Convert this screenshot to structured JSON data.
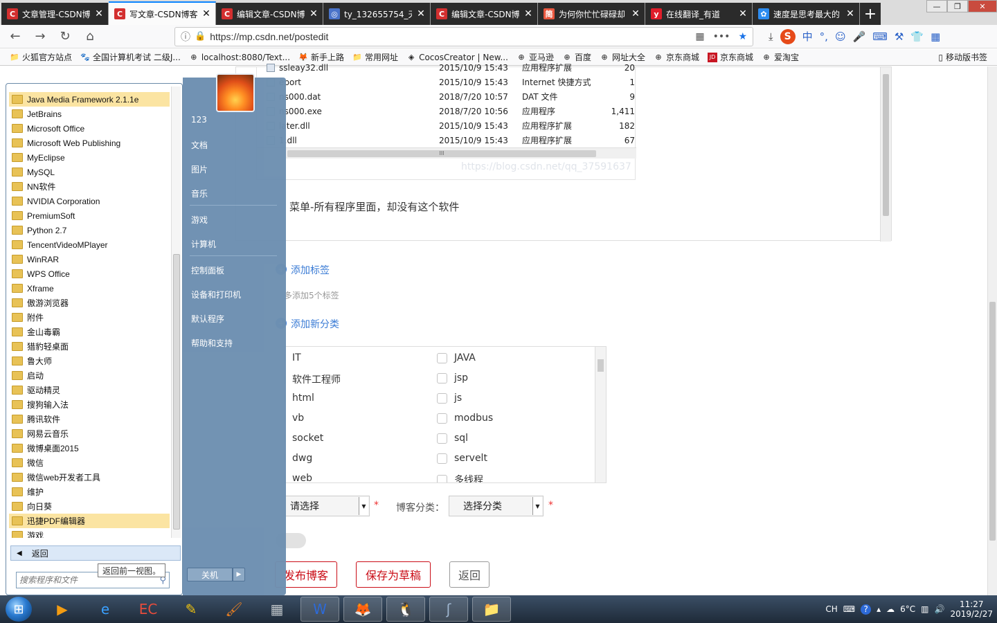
{
  "tabs": [
    {
      "title": "文章管理-CSDN博客",
      "fav": "C",
      "color": "#d32f2f",
      "active": false
    },
    {
      "title": "写文章-CSDN博客",
      "fav": "C",
      "color": "#d32f2f",
      "active": true
    },
    {
      "title": "编辑文章-CSDN博客",
      "fav": "C",
      "color": "#d32f2f",
      "active": false
    },
    {
      "title": "ty_132655754_天",
      "fav": "◎",
      "color": "#4a73c9",
      "active": false
    },
    {
      "title": "编辑文章-CSDN博客",
      "fav": "C",
      "color": "#d32f2f",
      "active": false
    },
    {
      "title": "为何你忙忙碌碌却",
      "fav": "简",
      "color": "#e9573f",
      "active": false
    },
    {
      "title": "在线翻译_有道",
      "fav": "y",
      "color": "#e01e2a",
      "active": false
    },
    {
      "title": "速度是思考最大的",
      "fav": "✿",
      "color": "#2d8cf0",
      "active": false
    }
  ],
  "url": "https://mp.csdn.net/postedit",
  "bookmarks": [
    {
      "label": "火狐官方站点",
      "icon": "folder"
    },
    {
      "label": "全国计算机考试 二级J...",
      "icon": "paw"
    },
    {
      "label": "localhost:8080/Text...",
      "icon": "globe"
    },
    {
      "label": "新手上路",
      "icon": "fox"
    },
    {
      "label": "常用网址",
      "icon": "folder"
    },
    {
      "label": "CocosCreator | New...",
      "icon": "cocos"
    },
    {
      "label": "亚马逊",
      "icon": "globe"
    },
    {
      "label": "百度",
      "icon": "globe"
    },
    {
      "label": "网址大全",
      "icon": "globe"
    },
    {
      "label": "京东商城",
      "icon": "globe"
    },
    {
      "label": "京东商城",
      "icon": "jd"
    },
    {
      "label": "爱淘宝",
      "icon": "globe"
    }
  ],
  "mobile_bookmarks": "移动版书签",
  "files": [
    {
      "name": "ssleay32.dll",
      "date": "2015/10/9 15:43",
      "type": "应用程序扩展",
      "size": "20"
    },
    {
      "name": "eport",
      "date": "2015/10/9 15:43",
      "type": "Internet 快捷方式",
      "size": "1"
    },
    {
      "name": "ns000.dat",
      "date": "2018/7/20 10:57",
      "type": "DAT 文件",
      "size": "9"
    },
    {
      "name": "ns000.exe",
      "date": "2018/7/20 10:56",
      "type": "应用程序",
      "size": "1,411"
    },
    {
      "name": "later.dll",
      "date": "2015/10/9 15:43",
      "type": "应用程序扩展",
      "size": "182"
    },
    {
      "name": "1.dll",
      "date": "2015/10/9 15:43",
      "type": "应用程序扩展",
      "size": "67"
    }
  ],
  "watermark": "https://blog.csdn.net/qq_37591637",
  "article_text": "菜单-所有程序里面，却没有这个软件",
  "tags": {
    "add_label": "添加标签",
    "hint": "多添加5个标签"
  },
  "categories": {
    "add_label": "添加新分类"
  },
  "category_options": [
    {
      "left": "IT",
      "right": "JAVA"
    },
    {
      "left": "软件工程师",
      "right": "jsp"
    },
    {
      "left": "html",
      "right": "js"
    },
    {
      "left": "vb",
      "right": "modbus"
    },
    {
      "left": "socket",
      "right": "sql"
    },
    {
      "left": "dwg",
      "right": "servelt"
    },
    {
      "left": "web",
      "right": "多线程"
    }
  ],
  "article_type": {
    "value": "请选择"
  },
  "blog_category": {
    "label": "博客分类：",
    "value": "选择分类"
  },
  "buttons": {
    "publish": "发布博客",
    "draft": "保存为草稿",
    "back": "返回"
  },
  "programs": [
    {
      "name": "Java Media Framework 2.1.1e",
      "highlight": true
    },
    {
      "name": "JetBrains"
    },
    {
      "name": "Microsoft Office"
    },
    {
      "name": "Microsoft Web Publishing"
    },
    {
      "name": "MyEclipse"
    },
    {
      "name": "MySQL"
    },
    {
      "name": "NN软件"
    },
    {
      "name": "NVIDIA Corporation"
    },
    {
      "name": "PremiumSoft"
    },
    {
      "name": "Python 2.7"
    },
    {
      "name": "TencentVideoMPlayer"
    },
    {
      "name": "WinRAR"
    },
    {
      "name": "WPS Office"
    },
    {
      "name": "Xframe"
    },
    {
      "name": "傲游浏览器"
    },
    {
      "name": "附件"
    },
    {
      "name": "金山毒霸"
    },
    {
      "name": "猎豹轻桌面"
    },
    {
      "name": "鲁大师"
    },
    {
      "name": "启动"
    },
    {
      "name": "驱动精灵"
    },
    {
      "name": "搜狗输入法"
    },
    {
      "name": "腾讯软件"
    },
    {
      "name": "网易云音乐"
    },
    {
      "name": "微博桌面2015"
    },
    {
      "name": "微信"
    },
    {
      "name": "微信web开发者工具"
    },
    {
      "name": "维护"
    },
    {
      "name": "向日葵"
    },
    {
      "name": "迅捷PDF编辑器",
      "highlight": true
    },
    {
      "name": "游戏"
    }
  ],
  "start_menu": {
    "back": "返回",
    "back_tooltip": "返回前一视图。",
    "search_placeholder": "搜索程序和文件",
    "shutdown": "关机",
    "right_links": [
      "123",
      "文档",
      "图片",
      "音乐",
      "游戏",
      "计算机",
      "控制面板",
      "设备和打印机",
      "默认程序",
      "帮助和支持"
    ]
  },
  "taskbar": {
    "apps": [
      "media-player-icon",
      "ie-icon",
      "ec-icon",
      "paint-icon",
      "brush-icon",
      "calculator-icon",
      "wps-icon",
      "firefox-icon",
      "qq-icon",
      "app-s-icon",
      "explorer-icon"
    ],
    "ime": "CH",
    "weather": "6°C",
    "time": "11:27",
    "date": "2019/2/27"
  }
}
